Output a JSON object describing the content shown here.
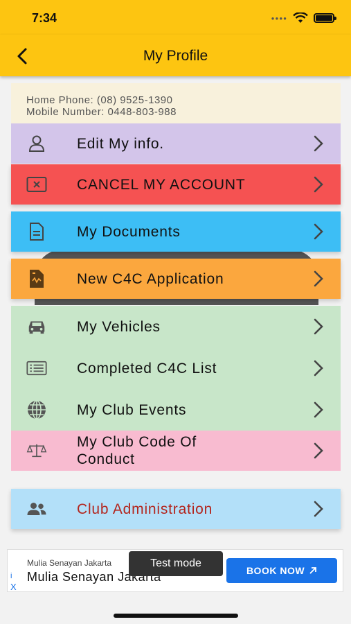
{
  "status": {
    "time": "7:34"
  },
  "nav": {
    "title": "My Profile"
  },
  "info": {
    "home_phone": "Home Phone: (08) 9525-1390",
    "mobile": "Mobile Number: 0448-803-988"
  },
  "menu": [
    {
      "label": "Edit My info.",
      "icon": "person-icon",
      "color": "#d3c5ea"
    },
    {
      "label": "CANCEL MY ACCOUNT",
      "icon": "cancel-box-icon",
      "color": "#f55252"
    },
    {
      "label": "My Documents",
      "icon": "document-icon",
      "color": "#3dbef5"
    },
    {
      "label": "New C4C Application",
      "icon": "application-icon",
      "color": "#fba73e"
    },
    {
      "label": "My Vehicles",
      "icon": "car-icon",
      "color": "#c8e6c9"
    },
    {
      "label": "Completed C4C List",
      "icon": "list-icon",
      "color": "#c8e6c9"
    },
    {
      "label": "My Club Events",
      "icon": "globe-icon",
      "color": "#c8e6c9"
    },
    {
      "label": "My Club Code Of Conduct",
      "icon": "scales-icon",
      "color": "#f8bbd0"
    },
    {
      "label": "Club Administration",
      "icon": "group-icon",
      "color": "#b3e0f9",
      "label_color": "#b3261e"
    }
  ],
  "ad": {
    "small_text": "Mulia Senayan Jakarta",
    "big_text": "Mulia Senayan Jakarta",
    "button": "BOOK NOW",
    "test_mode": "Test mode",
    "close": "X",
    "info": "i"
  }
}
